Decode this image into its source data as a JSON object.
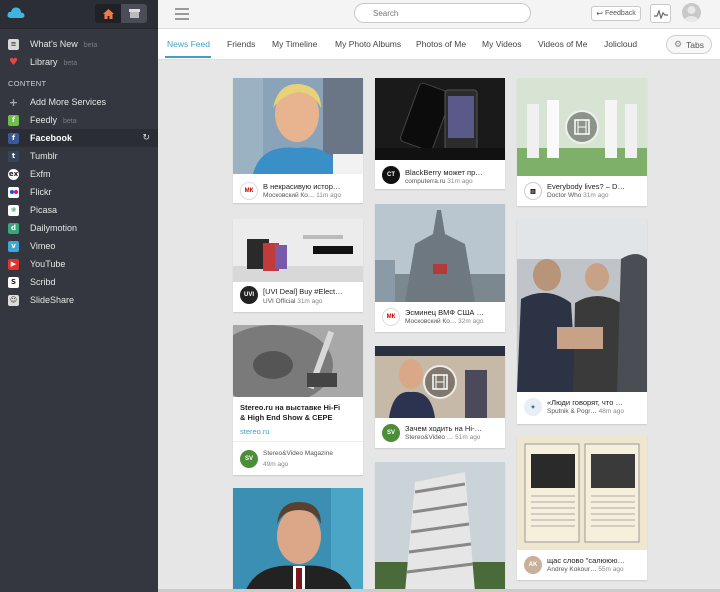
{
  "sidebar": {
    "items_top": [
      {
        "label": "What's New",
        "badge": "beta",
        "icon": "whats-new-icon"
      },
      {
        "label": "Library",
        "badge": "beta",
        "icon": "heart-icon"
      }
    ],
    "section_label": "CONTENT",
    "items": [
      {
        "label": "Add More Services",
        "icon": "plus-icon"
      },
      {
        "label": "Feedly",
        "badge": "beta",
        "icon": "feedly-icon"
      },
      {
        "label": "Facebook",
        "icon": "facebook-icon"
      },
      {
        "label": "Tumblr",
        "icon": "tumblr-icon"
      },
      {
        "label": "Exfm",
        "icon": "exfm-icon"
      },
      {
        "label": "Flickr",
        "icon": "flickr-icon"
      },
      {
        "label": "Picasa",
        "icon": "picasa-icon"
      },
      {
        "label": "Dailymotion",
        "icon": "dailymotion-icon"
      },
      {
        "label": "Vimeo",
        "icon": "vimeo-icon"
      },
      {
        "label": "YouTube",
        "icon": "youtube-icon"
      },
      {
        "label": "Scribd",
        "icon": "scribd-icon"
      },
      {
        "label": "SlideShare",
        "icon": "slideshare-icon"
      }
    ],
    "refresh_icon": "refresh-icon"
  },
  "topbar": {
    "search_placeholder": "Search",
    "feedback_label": "Feedback"
  },
  "tabs": [
    "News Feed",
    "Friends",
    "My Timeline",
    "My Photo Albums",
    "Photos of Me",
    "My Videos",
    "Videos of Me",
    "Jolicloud"
  ],
  "tabs_button": "Tabs",
  "colors": {
    "accent": "#3fa1c5",
    "sidebar": "#34373f"
  },
  "cards": {
    "c1": {
      "caption": "В некрасивую истор…",
      "source": "Московский Ко…",
      "time": "11m ago"
    },
    "c2": {
      "caption": "[UVI Deal] Buy #Elect…",
      "source": "UVI Official",
      "time": "31m ago"
    },
    "c3": {
      "caption1": "Stereo.ru на выставке Hi-Fi",
      "caption2": "& High End Show & CEPE",
      "link": "stereo.ru",
      "source": "Stereo&Video Magazine",
      "time": "49m ago"
    },
    "c5": {
      "caption": "BlackBerry может пр…",
      "source": "computerra.ru",
      "time": "31m ago"
    },
    "c6": {
      "caption": "Эсминец ВМФ США …",
      "source": "Московский Ко…",
      "time": "32m ago"
    },
    "c7": {
      "caption": "Зачем ходить на Hi-…",
      "source": "Stereo&Video …",
      "time": "51m ago"
    },
    "c9": {
      "caption": "Everybody lives? – D…",
      "source": "Doctor Who",
      "time": "31m ago"
    },
    "c10": {
      "caption": "«Люди говорят, что …",
      "source": "Sputnik & Pogr…",
      "time": "48m ago"
    },
    "c11": {
      "caption": "щас слово \"салююю…",
      "source": "Andrey Kokour…",
      "time": "55m ago"
    }
  }
}
